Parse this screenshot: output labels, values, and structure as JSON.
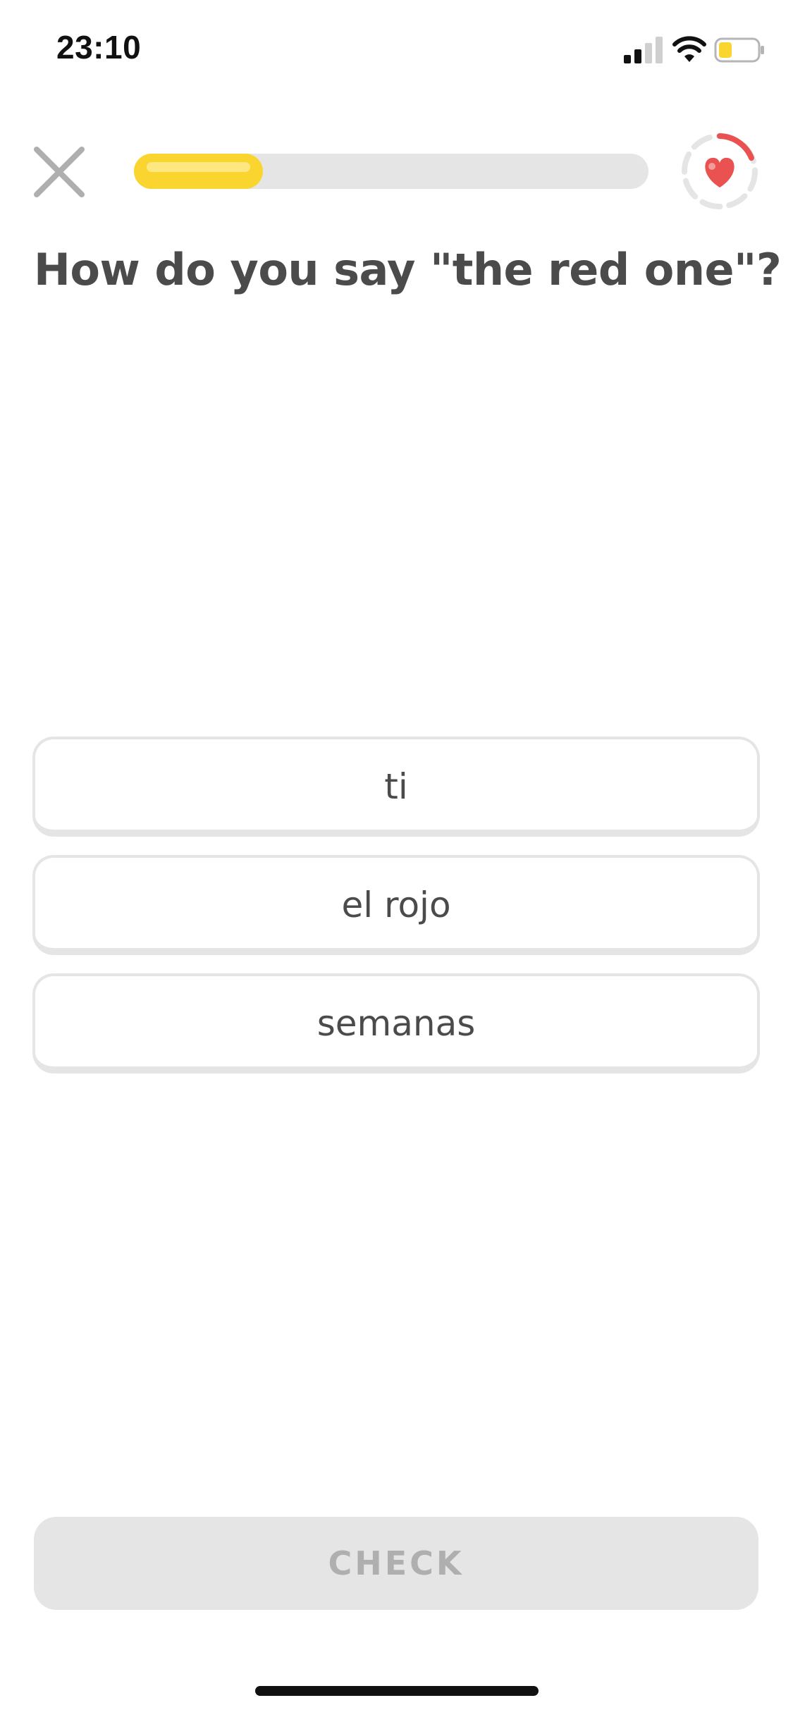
{
  "status_bar": {
    "time": "23:10",
    "icons": [
      "cellular-signal-icon",
      "wifi-icon",
      "battery-icon"
    ],
    "battery_level": 0.35,
    "battery_color": "#fad52f"
  },
  "header": {
    "close_icon": "close-icon",
    "progress": 0.25,
    "progress_color": "#fad52f",
    "track_color": "#e5e5e5",
    "hearts_icon": "heart-icon",
    "heart_color": "#ea5252"
  },
  "question": {
    "title": "How do you say \"the red one\"?"
  },
  "options": [
    {
      "label": "ti"
    },
    {
      "label": "el rojo"
    },
    {
      "label": "semanas"
    }
  ],
  "footer": {
    "check_label": "CHECK",
    "check_enabled": false
  }
}
